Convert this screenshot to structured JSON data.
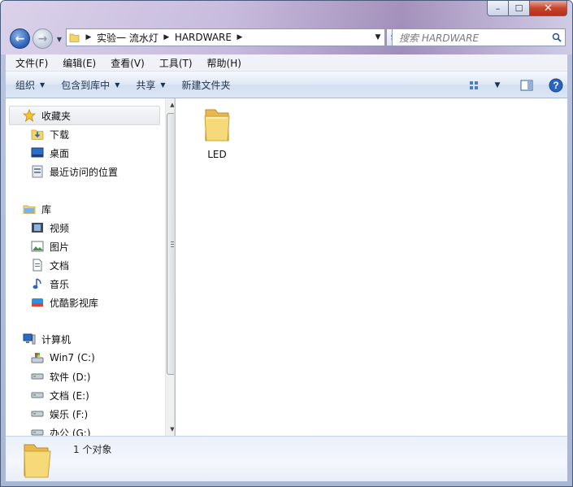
{
  "window": {
    "caption_buttons": [
      "–",
      "☐",
      "✕"
    ]
  },
  "address_bar": {
    "crumbs": [
      "实验一 流水灯",
      "HARDWARE"
    ]
  },
  "search": {
    "placeholder": "搜索 HARDWARE"
  },
  "menu": {
    "items": [
      "文件(F)",
      "编辑(E)",
      "查看(V)",
      "工具(T)",
      "帮助(H)"
    ]
  },
  "commandbar": {
    "organize": "组织",
    "include_in_library": "包含到库中",
    "share": "共享",
    "new_folder": "新建文件夹"
  },
  "nav": {
    "favorites": {
      "label": "收藏夹",
      "items": [
        "下载",
        "桌面",
        "最近访问的位置"
      ]
    },
    "libraries": {
      "label": "库",
      "items": [
        "视频",
        "图片",
        "文档",
        "音乐",
        "优酷影视库"
      ]
    },
    "computer": {
      "label": "计算机",
      "items": [
        "Win7 (C:)",
        "软件 (D:)",
        "文档 (E:)",
        "娱乐 (F:)",
        "办公 (G:)"
      ]
    }
  },
  "content": {
    "files": [
      {
        "name": "LED",
        "icon": "folder-icon"
      }
    ]
  },
  "details": {
    "status": "1 个对象"
  },
  "colors": {
    "folder": "#f3d46a",
    "accent": "#2a5db5",
    "cmdbar": "#dfe8f5"
  }
}
